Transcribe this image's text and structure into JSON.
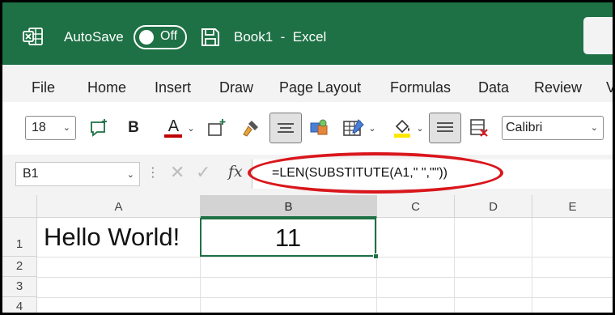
{
  "titlebar": {
    "autosave_label": "AutoSave",
    "autosave_state": "Off",
    "doc_title": "Book1  -  Excel",
    "bg_color": "#1e7145"
  },
  "menu": [
    "File",
    "Home",
    "Insert",
    "Draw",
    "Page Layout",
    "Formulas",
    "Data",
    "Review",
    "V"
  ],
  "ribbon": {
    "font_size": "18",
    "font_name": "Calibri",
    "bold_label": "B",
    "font_color_label": "A",
    "font_color": "#c00000",
    "icons": [
      "new-comment-icon",
      "bold-icon",
      "font-color-icon",
      "insert-cells-icon",
      "format-painter-icon",
      "align-center-icon",
      "3d-shapes-icon",
      "format-table-icon",
      "fill-color-icon",
      "align-justify-icon",
      "clear-format-icon"
    ]
  },
  "formula_bar": {
    "name_box": "B1",
    "fx": "fx",
    "formula": "=LEN(SUBSTITUTE(A1,\" \",\"\"))",
    "annotation_color": "#d9161c"
  },
  "grid": {
    "columns": [
      "A",
      "B",
      "C",
      "D",
      "E"
    ],
    "rows": [
      "1",
      "2",
      "3",
      "4"
    ],
    "cells": {
      "A1": "Hello World!",
      "B1": "11"
    },
    "active_cell": "B1",
    "accent": "#1e7145"
  }
}
